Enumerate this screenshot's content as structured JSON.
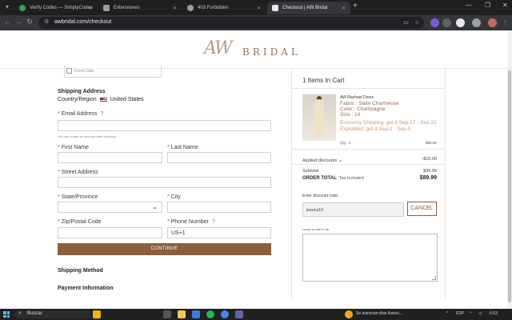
{
  "browser": {
    "tabs": [
      {
        "title": "Verify Codes — SimplyCodes",
        "fav_color": "#34a853"
      },
      {
        "title": "Extensiones",
        "fav_color": "#9aa0a6"
      },
      {
        "title": "403 Forbidden",
        "fav_color": "#9aa0a6"
      },
      {
        "title": "Checkout | AW Bridal",
        "fav_color": "#e8eaed"
      }
    ],
    "url": "awbridal.com/checkout"
  },
  "brand": {
    "mark": "AW",
    "word": "BRIDAL"
  },
  "form": {
    "event_date_placeholder": "Event Date",
    "shipping_address_title": "Shipping Address",
    "country_label": "Country/Region",
    "country_value": "United States",
    "email_label": "Email Address",
    "email_hint": "You can create an account after checkout",
    "first_name_label": "First Name",
    "last_name_label": "Last Name",
    "street_label": "Street Address",
    "state_label": "State/Province",
    "city_label": "City",
    "zip_label": "Zip/Postal Code",
    "phone_label": "Phone Number",
    "phone_prefix": "US+1",
    "continue_label": "CONTINUE",
    "shipping_method_title": "Shipping Method",
    "payment_info_title": "Payment Information"
  },
  "cart": {
    "title": "1 Items In Cart",
    "product": {
      "name": "AW Rachael Dress",
      "fabric": "Fabric : Satin Charmeuse",
      "color": "Color : Champagne",
      "size": "Size : 14",
      "economy_shipping": "Economy Shipping: get it Sep.17 - Sep.22",
      "expedited_shipping": "Expedited: get it Sep.2 - Sep.9",
      "qty": "Qty : 1",
      "price": "$99.99"
    },
    "applied_discounts_label": "Applied discounts",
    "applied_discounts_value": "-$10.00",
    "subtotal_label": "Subtotal",
    "subtotal_value": "$99.99",
    "order_total_label": "ORDER TOTAL",
    "tax_included_label": "Tax Included",
    "order_total_value": "$89.99",
    "discount_code_label": "Enter discount code",
    "discount_code_value": "jessica10",
    "cancel_label": "CANCEL",
    "note_label": "Leave a note to us"
  },
  "taskbar": {
    "search_label": "Buscar",
    "weather_text": "Se avecinan días lluvios...",
    "language": "ESP",
    "time": "6:53"
  },
  "colors": {
    "accent": "#8b5e3c",
    "ship_text": "#c89a7a",
    "required": "#c0392b"
  }
}
